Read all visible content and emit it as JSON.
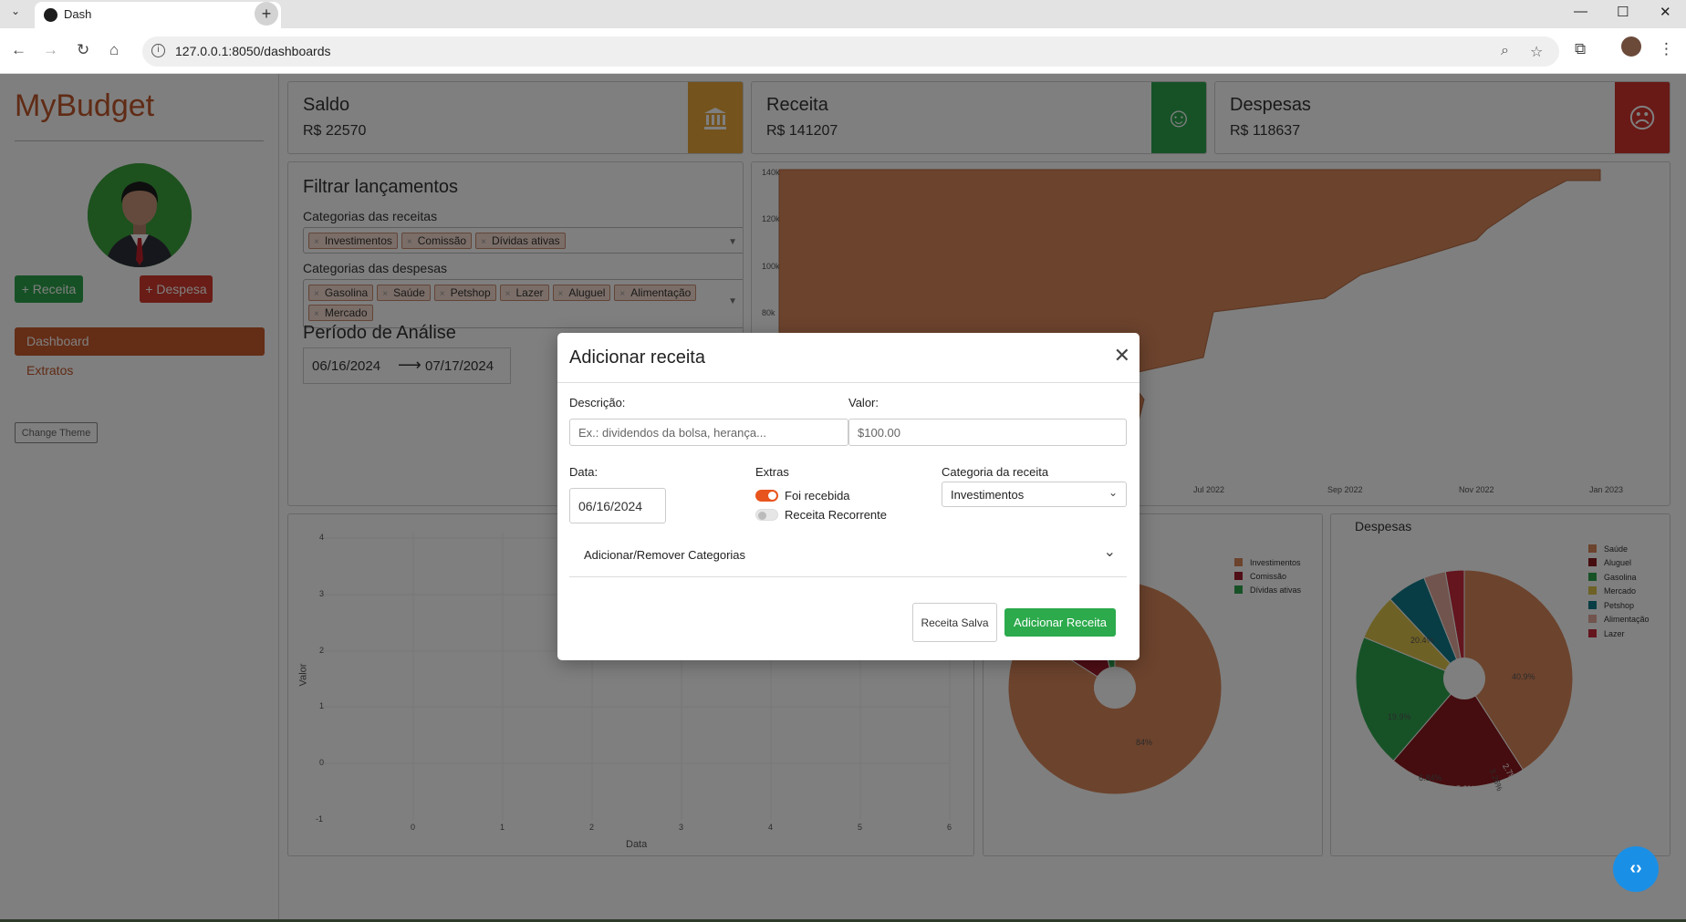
{
  "browser": {
    "tab_title": "Dash",
    "url": "127.0.0.1:8050/dashboards"
  },
  "sidebar": {
    "brand": "MyBudget",
    "btn_receita": "+ Receita",
    "btn_despesa": "+ Despesa",
    "nav_dashboard": "Dashboard",
    "nav_extratos": "Extratos",
    "btn_theme": "Change Theme"
  },
  "kpis": [
    {
      "title": "Saldo",
      "value": "R$ 22570",
      "color": "#e8a63a",
      "icon": "bank-icon"
    },
    {
      "title": "Receita",
      "value": "R$ 141207",
      "color": "#2ea44f",
      "icon": "smile-icon"
    },
    {
      "title": "Despesas",
      "value": "R$ 118637",
      "color": "#d2322d",
      "icon": "frown-icon"
    }
  ],
  "filters": {
    "title": "Filtrar lançamentos",
    "receitas_label": "Categorias das receitas",
    "receitas_chips": [
      "Investimentos",
      "Comissão",
      "Dívidas ativas"
    ],
    "despesas_label": "Categorias das despesas",
    "despesas_chips": [
      "Gasolina",
      "Saúde",
      "Petshop",
      "Lazer",
      "Aluguel",
      "Alimentação",
      "Mercado"
    ],
    "period_title": "Período de Análise",
    "date_start": "06/16/2024",
    "date_end": "07/17/2024"
  },
  "chart_data": [
    {
      "type": "area",
      "y_ticks": [
        "140k",
        "120k",
        "100k",
        "80k"
      ],
      "x_ticks": [
        "Jul 2022",
        "Sep 2022",
        "Nov 2022",
        "Jan 2023"
      ],
      "fill_color": "#d9875b"
    },
    {
      "type": "scatter",
      "ylabel": "Valor",
      "xlabel": "Data",
      "y_ticks": [
        "4",
        "3",
        "2",
        "1",
        "0",
        "-1"
      ],
      "x_ticks": [
        "0",
        "1",
        "2",
        "3",
        "4",
        "5",
        "6"
      ],
      "xlim": [
        -1,
        6
      ],
      "ylim": [
        -1,
        4
      ]
    },
    {
      "type": "pie",
      "legend": [
        "Investimentos",
        "Comissão",
        "Dívidas ativas"
      ],
      "colors": [
        "#d9875b",
        "#a01c2c",
        "#2ea44f"
      ],
      "labels": [
        "84%"
      ],
      "values": [
        84,
        12,
        4
      ]
    },
    {
      "type": "pie",
      "title": "Despesas",
      "legend": [
        "Saúde",
        "Aluguel",
        "Gasolina",
        "Mercado",
        "Petshop",
        "Alimentação",
        "Lazer"
      ],
      "colors": [
        "#d9875b",
        "#8b1a1f",
        "#2ea44f",
        "#dcc24a",
        "#137a8a",
        "#e3a99a",
        "#c92b3a"
      ],
      "labels": [
        "40.9%",
        "20.4%",
        "19.9%",
        "6.84%",
        "5.9%",
        "3.26%",
        "2.79%"
      ],
      "values": [
        40.9,
        20.4,
        19.9,
        6.84,
        5.9,
        3.26,
        2.79
      ]
    }
  ],
  "modal": {
    "title": "Adicionar receita",
    "descricao_label": "Descrição:",
    "descricao_placeholder": "Ex.: dividendos da bolsa, herança...",
    "valor_label": "Valor:",
    "valor_placeholder": "$100.00",
    "data_label": "Data:",
    "data_value": "06/16/2024",
    "extras_label": "Extras",
    "toggle_recebida": "Foi recebida",
    "toggle_recebida_on": true,
    "toggle_recorrente": "Receita Recorrente",
    "toggle_recorrente_on": false,
    "categoria_label": "Categoria da receita",
    "categoria_value": "Investimentos",
    "accordion_label": "Adicionar/Remover Categorias",
    "btn_saved": "Receita Salva",
    "btn_add": "Adicionar Receita"
  }
}
